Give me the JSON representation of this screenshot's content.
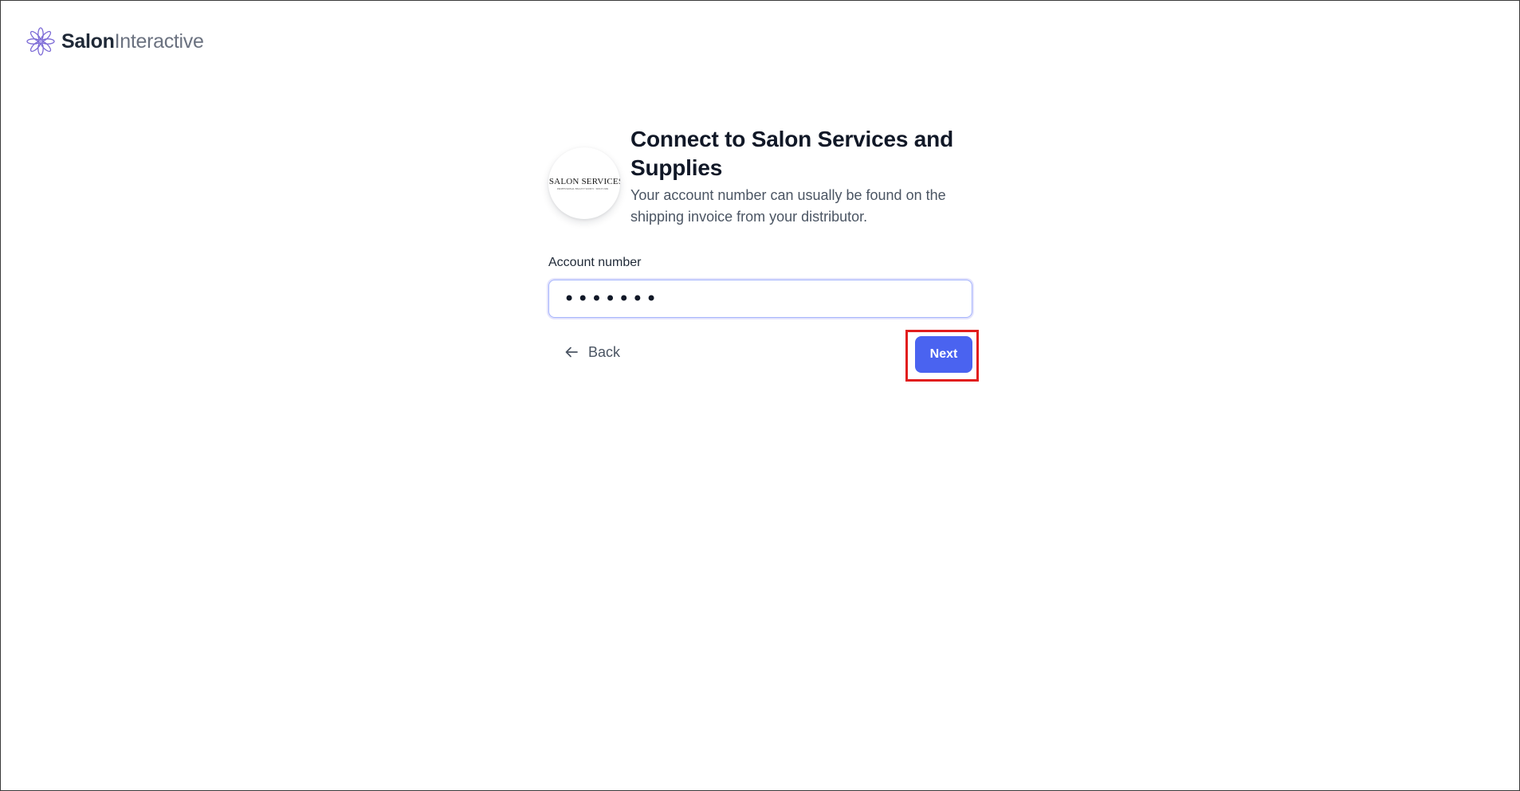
{
  "brand": {
    "name_part1": "Salon",
    "name_part2": "Interactive",
    "icon": "flower-logo-icon",
    "colors": {
      "primary": "#6d5bd0",
      "secondary": "#a78bfa"
    }
  },
  "distributor": {
    "logo_text": "SALON SERVICES",
    "logo_subtext": "PROFESSIONAL BEAUTY SUPPLY · SINCE 1969",
    "logo_mark_color": "#8b1a2b"
  },
  "form": {
    "title": "Connect to Salon Services and Supplies",
    "subtitle": "Your account number can usually be found on the shipping invoice from your distributor.",
    "account_label": "Account number",
    "account_value": "1234567",
    "account_type": "password"
  },
  "actions": {
    "back_label": "Back",
    "next_label": "Next",
    "next_color": "#4a63f0",
    "highlight_color": "#e11d1d"
  }
}
